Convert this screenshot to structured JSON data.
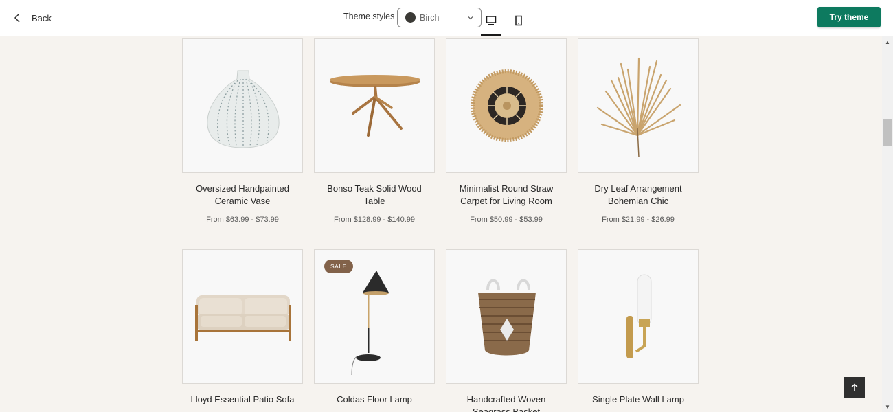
{
  "header": {
    "back_label": "Back",
    "theme_styles_label": "Theme styles",
    "theme_value": "Birch",
    "try_label": "Try theme",
    "colors": {
      "accent": "#0d7a5f",
      "swatch": "#3b3a36"
    }
  },
  "products": [
    {
      "title": "Oversized Handpainted Ceramic Vase",
      "price": "From $63.99 - $73.99",
      "icon": "vase-image"
    },
    {
      "title": "Bonso Teak Solid Wood Table",
      "price": "From $128.99 - $140.99",
      "icon": "table-image"
    },
    {
      "title": "Minimalist Round Straw Carpet for Living Room",
      "price": "From $50.99 - $53.99",
      "icon": "straw-carpet-image"
    },
    {
      "title": "Dry Leaf Arrangement Bohemian Chic",
      "price": "From $21.99 - $26.99",
      "icon": "dry-leaf-image"
    },
    {
      "title": "Lloyd Essential Patio Sofa",
      "price": "",
      "icon": "sofa-image"
    },
    {
      "title": "Coldas Floor Lamp",
      "price": "",
      "icon": "floor-lamp-image",
      "badge": "SALE"
    },
    {
      "title": "Handcrafted Woven Seagrass Basket",
      "price": "",
      "icon": "basket-image"
    },
    {
      "title": "Single Plate Wall Lamp",
      "price": "",
      "icon": "wall-lamp-image"
    }
  ]
}
